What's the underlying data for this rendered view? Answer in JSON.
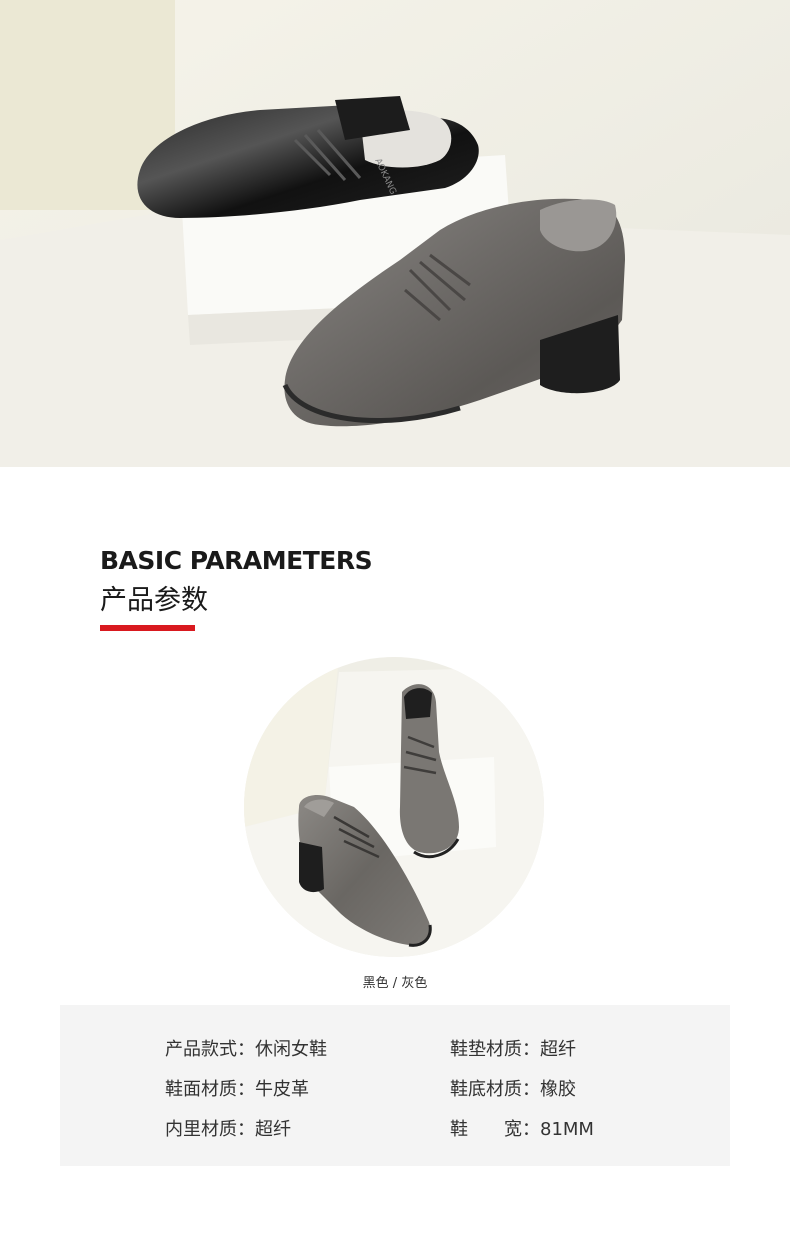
{
  "hero": {
    "shoe_brand_text": "AOKANG"
  },
  "section": {
    "title_en": "BASIC PARAMETERS",
    "title_cn": "产品参数",
    "accent_color": "#d9191f"
  },
  "colors_caption": "黑色 / 灰色",
  "params": [
    {
      "label": "产品款式",
      "value": "休闲女鞋"
    },
    {
      "label": "鞋垫材质",
      "value": "超纤"
    },
    {
      "label": "鞋面材质",
      "value": "牛皮革"
    },
    {
      "label": "鞋底材质",
      "value": "橡胶"
    },
    {
      "label": "内里材质",
      "value": "超纤"
    },
    {
      "label": "鞋　　宽",
      "value": "81MM"
    }
  ],
  "separator": "："
}
